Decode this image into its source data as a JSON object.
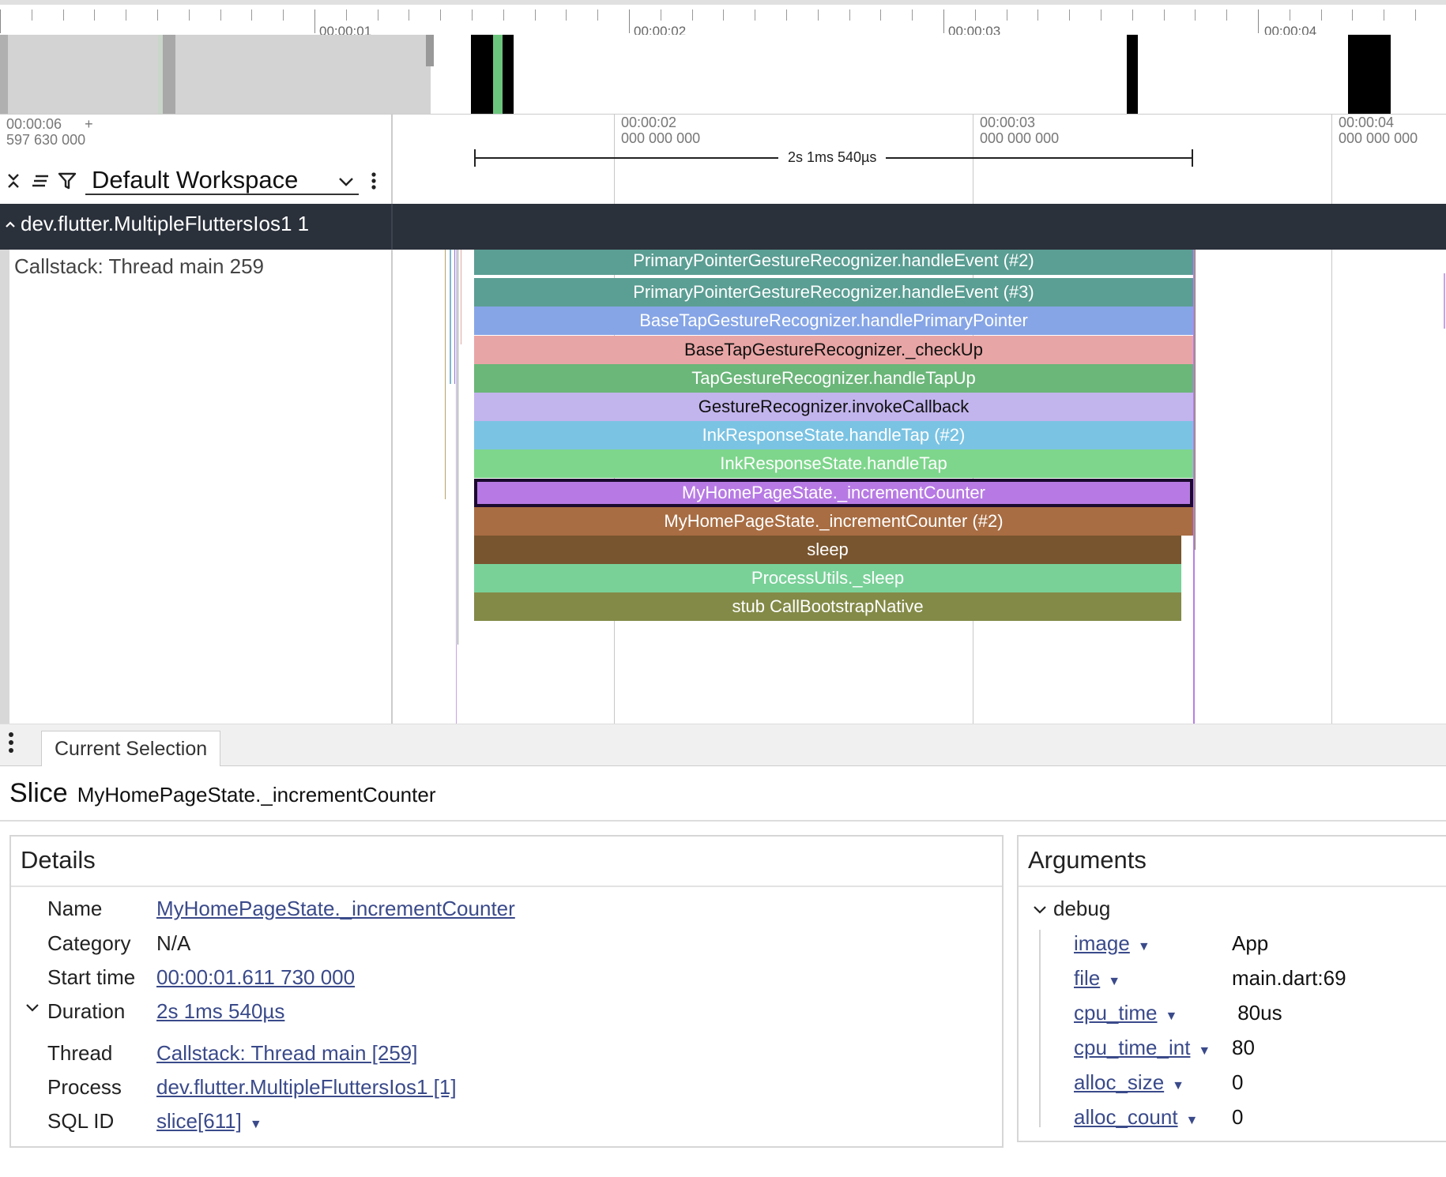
{
  "overview": {
    "labels": [
      "00:00:01",
      "00:00:02",
      "00:00:03",
      "00:00:04"
    ]
  },
  "left_header": {
    "time_line1": "00:00:06",
    "time_plus": "+",
    "time_line2": "597 630 000",
    "workspace": "Default Workspace",
    "icons": [
      "collapse-icon",
      "sort-icon",
      "filter-icon",
      "more-vert-icon"
    ]
  },
  "time_header": {
    "ticks": [
      {
        "line1": "00:00:02",
        "line2": "000 000 000"
      },
      {
        "line1": "00:00:03",
        "line2": "000 000 000"
      },
      {
        "line1": "00:00:04",
        "line2": "000 000 000"
      }
    ],
    "span_label": "2s 1ms 540µs"
  },
  "group": {
    "title": "dev.flutter.MultipleFluttersIos1 1",
    "chevron": "^"
  },
  "track": {
    "name": "Callstack: Thread main 259",
    "slices": [
      {
        "label": "PrimaryPointerGestureRecognizer.handleEvent (#2)",
        "color": "#5b9e93"
      },
      {
        "label": "PrimaryPointerGestureRecognizer.handleEvent (#3)",
        "color": "#5b9e93"
      },
      {
        "label": "BaseTapGestureRecognizer.handlePrimaryPointer",
        "color": "#86a5e6"
      },
      {
        "label": "BaseTapGestureRecognizer._checkUp",
        "color": "#e8a5a5",
        "dark": true
      },
      {
        "label": "TapGestureRecognizer.handleTapUp",
        "color": "#6bb679"
      },
      {
        "label": "GestureRecognizer.invokeCallback",
        "color": "#c2b4ec",
        "dark": true
      },
      {
        "label": "InkResponseState.handleTap (#2)",
        "color": "#7bc3e3"
      },
      {
        "label": "InkResponseState.handleTap",
        "color": "#7ed68c"
      },
      {
        "label": "MyHomePageState._incrementCounter",
        "color": "#b77ae4",
        "selected": true
      },
      {
        "label": "MyHomePageState._incrementCounter (#2)",
        "color": "#a86d43"
      },
      {
        "label": "sleep",
        "color": "#78552e"
      },
      {
        "label": "ProcessUtils._sleep",
        "color": "#79d198"
      },
      {
        "label": "stub CallBootstrapNative",
        "color": "#838a47"
      }
    ]
  },
  "panel": {
    "tab": "Current Selection",
    "slice_word": "Slice",
    "slice_name": "MyHomePageState._incrementCounter",
    "details": {
      "title": "Details",
      "rows": [
        {
          "key": "Name",
          "value": "MyHomePageState._incrementCounter"
        },
        {
          "key": "Category",
          "value": "N/A"
        },
        {
          "key": "Start time",
          "value": "00:00:01.611 730 000"
        },
        {
          "key": "Duration",
          "value": "2s 1ms 540µs"
        },
        {
          "key": "Thread",
          "value": "Callstack: Thread main [259]"
        },
        {
          "key": "Process",
          "value": "dev.flutter.MultipleFluttersIos1 [1]"
        },
        {
          "key": "SQL ID",
          "value": "slice[611]"
        }
      ]
    },
    "arguments": {
      "title": "Arguments",
      "group": "debug",
      "rows": [
        {
          "key": "image",
          "value": "App"
        },
        {
          "key": "file",
          "value": "main.dart:69"
        },
        {
          "key": "cpu_time",
          "value": " 80us"
        },
        {
          "key": "cpu_time_int",
          "value": "80"
        },
        {
          "key": "alloc_size",
          "value": "0"
        },
        {
          "key": "alloc_count",
          "value": "0"
        }
      ]
    }
  },
  "colors": {
    "group_header_bg": "#2b313b",
    "link": "#3a4a8a",
    "selected_border": "#1b0a2e"
  }
}
